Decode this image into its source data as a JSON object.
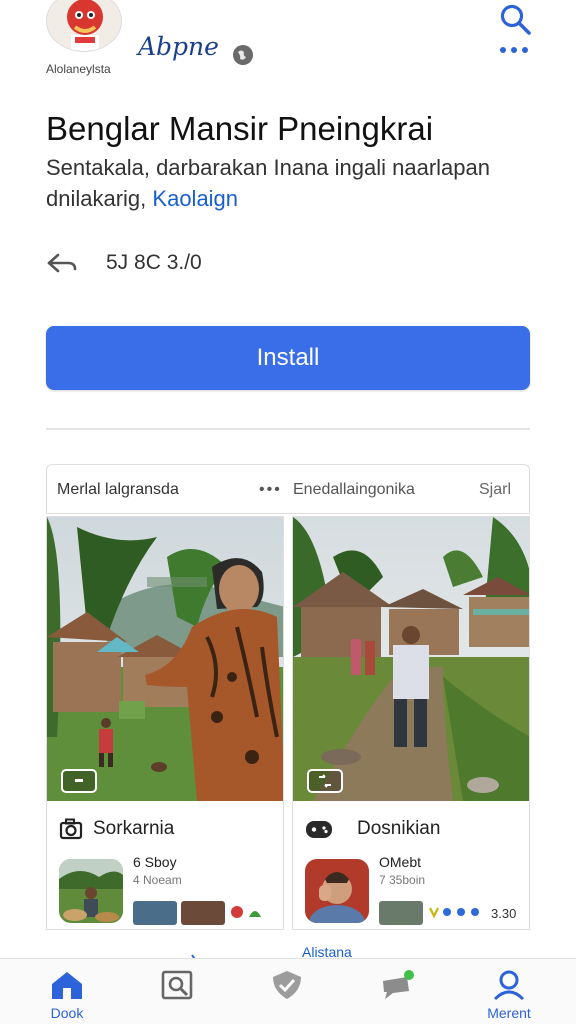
{
  "header": {
    "developer_name": "Alolaneylsta",
    "brand": "Abpne"
  },
  "app": {
    "title": "Benglar Mansir Pneingkrai",
    "description": "Sentakala, darbarakan Inana ingali naarlapan dnilakarig,",
    "description_link": "Kaolaign",
    "stats": "5J 8C  3./0"
  },
  "install": {
    "label": "Install"
  },
  "section": {
    "left_label": "Merlal lalgransda",
    "dots": "•••",
    "mid_label": "Enedallaingonika",
    "right_label": "Sjarl"
  },
  "tiles": [
    {
      "title": "Sorkarnia",
      "meta_line1": "6 Sboy",
      "meta_line2": "4 Noeam"
    },
    {
      "title": "Dosnikian",
      "meta_line1": "OMebt",
      "meta_line2": "7 35boin",
      "rating": "3.30"
    }
  ],
  "strip": {
    "label": "Alistana"
  },
  "nav": [
    {
      "label": "Dook",
      "icon": "home-icon",
      "active": true
    },
    {
      "label": "",
      "icon": "search-list-icon",
      "active": false
    },
    {
      "label": "",
      "icon": "shield-check-icon",
      "active": false
    },
    {
      "label": "",
      "icon": "chat-icon",
      "active": false
    },
    {
      "label": "Merent",
      "icon": "person-icon",
      "active": true
    }
  ],
  "colors": {
    "accent": "#3a6ee8",
    "link": "#1a5fd0",
    "brand": "#1a3e8a"
  }
}
